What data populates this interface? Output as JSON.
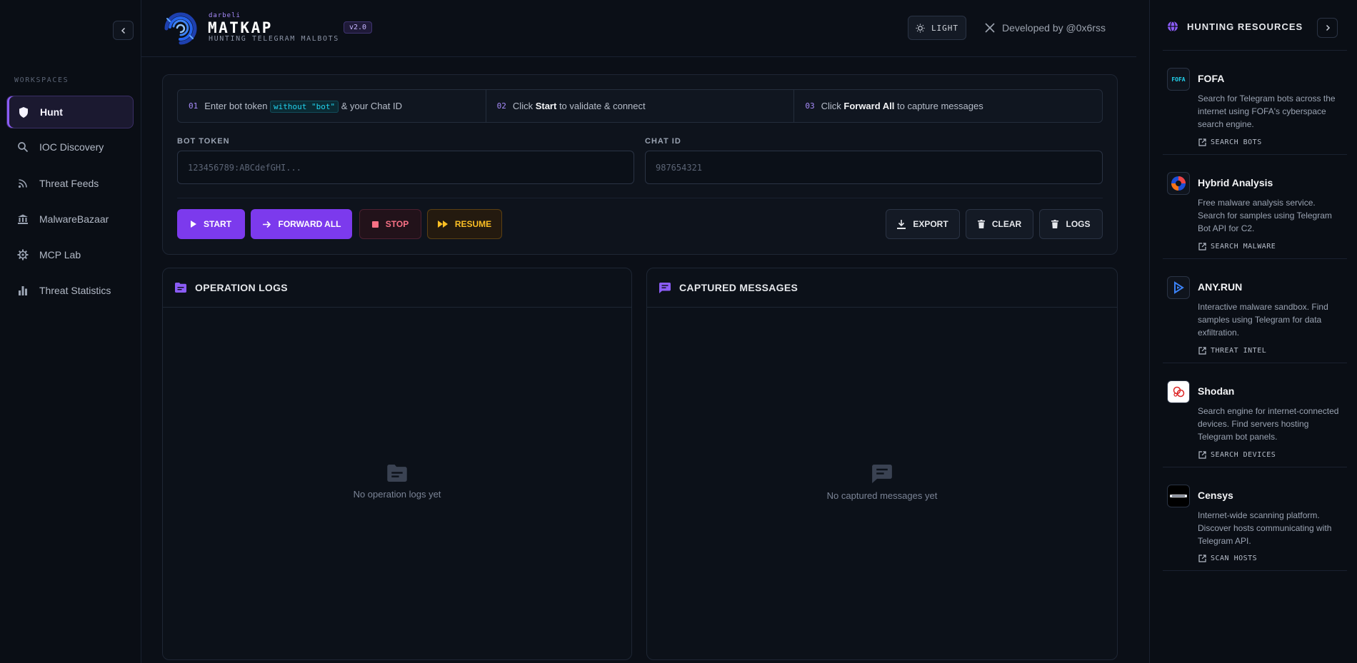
{
  "sidebar": {
    "section_label": "WORKSPACES",
    "items": [
      {
        "label": "Hunt",
        "icon": "shield-icon",
        "active": true
      },
      {
        "label": "IOC Discovery",
        "icon": "search-icon",
        "active": false
      },
      {
        "label": "Threat Feeds",
        "icon": "rss-icon",
        "active": false
      },
      {
        "label": "MalwareBazaar",
        "icon": "bank-icon",
        "active": false
      },
      {
        "label": "MCP Lab",
        "icon": "gear-icon",
        "active": false
      },
      {
        "label": "Threat Statistics",
        "icon": "bar-chart-icon",
        "active": false
      }
    ]
  },
  "header": {
    "brand_small": "darbeli",
    "brand_title": "MATKAP",
    "brand_subtitle": "HUNTING TELEGRAM MALBOTS",
    "version": "v2.0",
    "theme_label": "LIGHT",
    "developer": "Developed by @0x6rss"
  },
  "steps": [
    {
      "num": "01",
      "pre": "Enter bot token ",
      "code": "without \"bot\"",
      "post": " & your Chat ID"
    },
    {
      "num": "02",
      "pre": "Click ",
      "bold": "Start",
      "post": " to validate & connect"
    },
    {
      "num": "03",
      "pre": "Click ",
      "bold": "Forward All",
      "post": " to capture messages"
    }
  ],
  "form": {
    "bot_token_label": "BOT TOKEN",
    "bot_token_placeholder": "123456789:ABCdefGHI...",
    "chat_id_label": "CHAT ID",
    "chat_id_placeholder": "987654321"
  },
  "actions": {
    "start": "START",
    "forward_all": "FORWARD ALL",
    "stop": "STOP",
    "resume": "RESUME",
    "export": "EXPORT",
    "clear": "CLEAR",
    "logs": "LOGS"
  },
  "panels": {
    "logs_title": "OPERATION LOGS",
    "logs_empty": "No operation logs yet",
    "messages_title": "CAPTURED MESSAGES",
    "messages_empty": "No captured messages yet"
  },
  "resources": {
    "title": "HUNTING RESOURCES",
    "items": [
      {
        "name": "FOFA",
        "logo_text": "FOFA",
        "description": "Search for Telegram bots across the internet using FOFA's cyberspace search engine.",
        "link": "SEARCH BOTS"
      },
      {
        "name": "Hybrid Analysis",
        "description": "Free malware analysis service. Search for samples using Telegram Bot API for C2.",
        "link": "SEARCH MALWARE"
      },
      {
        "name": "ANY.RUN",
        "description": "Interactive malware sandbox. Find samples using Telegram for data exfiltration.",
        "link": "THREAT INTEL"
      },
      {
        "name": "Shodan",
        "description": "Search engine for internet-connected devices. Find servers hosting Telegram bot panels.",
        "link": "SEARCH DEVICES"
      },
      {
        "name": "Censys",
        "description": "Internet-wide scanning platform. Discover hosts communicating with Telegram API.",
        "link": "SCAN HOSTS"
      }
    ]
  },
  "colors": {
    "accent": "#7c3aed",
    "background": "#0b0f17",
    "stop": "#f87185",
    "resume": "#fbbf24"
  }
}
